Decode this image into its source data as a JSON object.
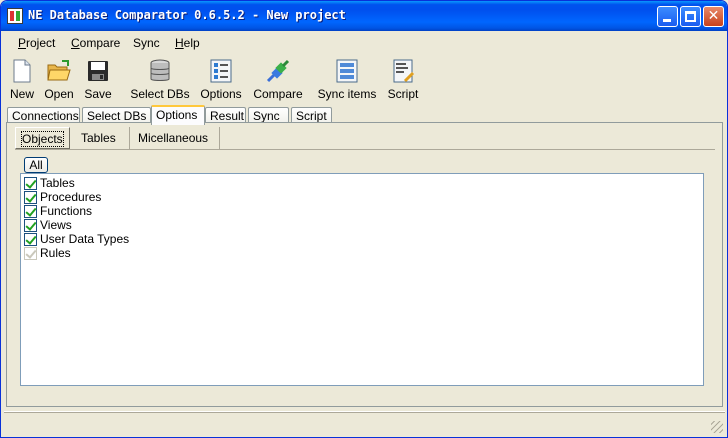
{
  "window": {
    "title": "NE Database Comparator 0.6.5.2 - New project",
    "minimize_glyph": "",
    "maximize_glyph": "",
    "close_glyph": "✕"
  },
  "menu": {
    "items": [
      {
        "first": "P",
        "rest": "roject"
      },
      {
        "first": "C",
        "rest": "ompare"
      },
      {
        "first": "",
        "rest": "Sync"
      },
      {
        "first": "H",
        "rest": "elp"
      }
    ]
  },
  "toolbar": {
    "items": [
      {
        "label": "New",
        "icon": "new-file-icon"
      },
      {
        "label": "Open",
        "icon": "open-folder-icon"
      },
      {
        "label": "Save",
        "icon": "save-disk-icon"
      },
      {
        "label": "Select DBs",
        "icon": "database-icon"
      },
      {
        "label": "Options",
        "icon": "options-list-icon"
      },
      {
        "label": "Compare",
        "icon": "compare-plug-icon"
      },
      {
        "label": "Sync items",
        "icon": "sync-items-icon"
      },
      {
        "label": "Script",
        "icon": "script-icon"
      }
    ]
  },
  "tabs": {
    "items": [
      "Connections",
      "Select DBs",
      "Options",
      "Result",
      "Sync",
      "Script"
    ],
    "active": "Options"
  },
  "options": {
    "subtabs": [
      "Objects",
      "Tables",
      "Micellaneous"
    ],
    "active_subtab": "Objects",
    "all_button": "All",
    "objects": [
      {
        "label": "Tables",
        "checked": true,
        "enabled": true
      },
      {
        "label": "Procedures",
        "checked": true,
        "enabled": true
      },
      {
        "label": "Functions",
        "checked": true,
        "enabled": true
      },
      {
        "label": "Views",
        "checked": true,
        "enabled": true
      },
      {
        "label": "User Data Types",
        "checked": true,
        "enabled": true
      },
      {
        "label": "Rules",
        "checked": true,
        "enabled": false
      }
    ]
  },
  "colors": {
    "titlebar": "#0055e5",
    "window_bg": "#ece9d8",
    "active_tab_accent": "#ffc83c",
    "checkmark": "#21a121"
  }
}
